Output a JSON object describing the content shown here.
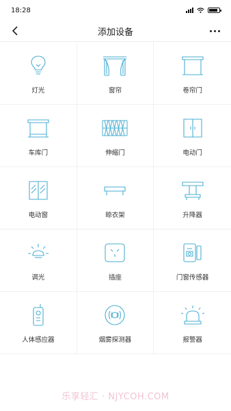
{
  "status_bar": {
    "time": "18:28"
  },
  "header": {
    "title": "添加设备"
  },
  "devices": [
    {
      "label": "灯光",
      "icon": "bulb-icon"
    },
    {
      "label": "窗帘",
      "icon": "curtain-icon"
    },
    {
      "label": "卷帘门",
      "icon": "roller-door-icon"
    },
    {
      "label": "车库门",
      "icon": "garage-door-icon"
    },
    {
      "label": "伸缩门",
      "icon": "retractable-gate-icon"
    },
    {
      "label": "电动门",
      "icon": "electric-door-icon"
    },
    {
      "label": "电动窗",
      "icon": "electric-window-icon"
    },
    {
      "label": "晾衣架",
      "icon": "clothes-rack-icon"
    },
    {
      "label": "升降器",
      "icon": "lifter-icon"
    },
    {
      "label": "调光",
      "icon": "dimmer-icon"
    },
    {
      "label": "插座",
      "icon": "socket-icon"
    },
    {
      "label": "门窗传感器",
      "icon": "door-window-sensor-icon"
    },
    {
      "label": "人体感应器",
      "icon": "body-sensor-icon"
    },
    {
      "label": "烟雾探测器",
      "icon": "smoke-detector-icon"
    },
    {
      "label": "报警器",
      "icon": "alarm-icon"
    }
  ],
  "watermark": "乐享轻汇 · NJYCOH.COM",
  "colors": {
    "icon_stroke": "#4aaed1",
    "divider": "#f0f0f0",
    "text": "#333333",
    "watermark": "#f2c3d4"
  }
}
